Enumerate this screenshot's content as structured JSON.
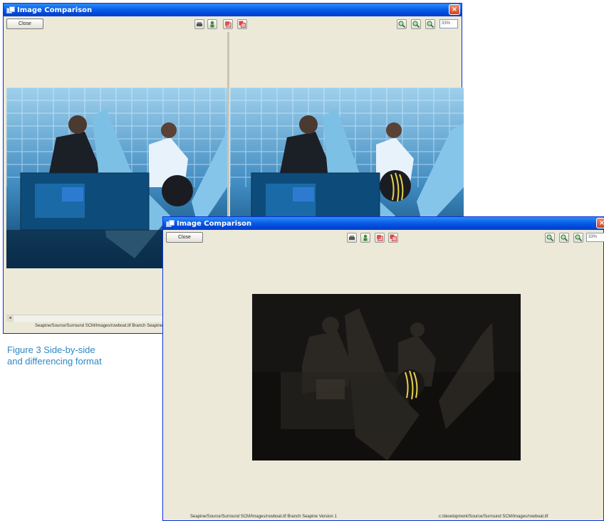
{
  "back_window": {
    "title": "Image Comparison",
    "close_button_label": "Close",
    "zoom_value": "33%",
    "status_path": "Seapine/Source/Surround SCM/Images/rowboat.tif  Branch Seapine",
    "scroll_arrow_glyph": "◂"
  },
  "front_window": {
    "title": "Image Comparison",
    "close_button_label": "Close",
    "zoom_value": "33%",
    "status_path_left": "Seapine/Source/Surround SCM/Images/rowboat.tif  Branch Seapine  Version 1",
    "status_path_right": "c:/development/Source/Surround SCM/Images/rowboat.tif"
  },
  "titlebar_close_glyph": "×",
  "caption": {
    "line1": "Figure 3 Side-by-side",
    "line2": "and differencing format"
  },
  "colors": {
    "titlebar": "#0a5fe6",
    "window_bg": "#ece9d8",
    "caption_text": "#2d88c6",
    "diff_bg": "#100f0e",
    "highlight_stripes": "#e8d24a"
  },
  "icons": [
    "printer-icon",
    "person-icon",
    "overlay-icon",
    "diff-icon",
    "zoom-in-icon",
    "zoom-out-icon",
    "zoom-fit-icon"
  ]
}
